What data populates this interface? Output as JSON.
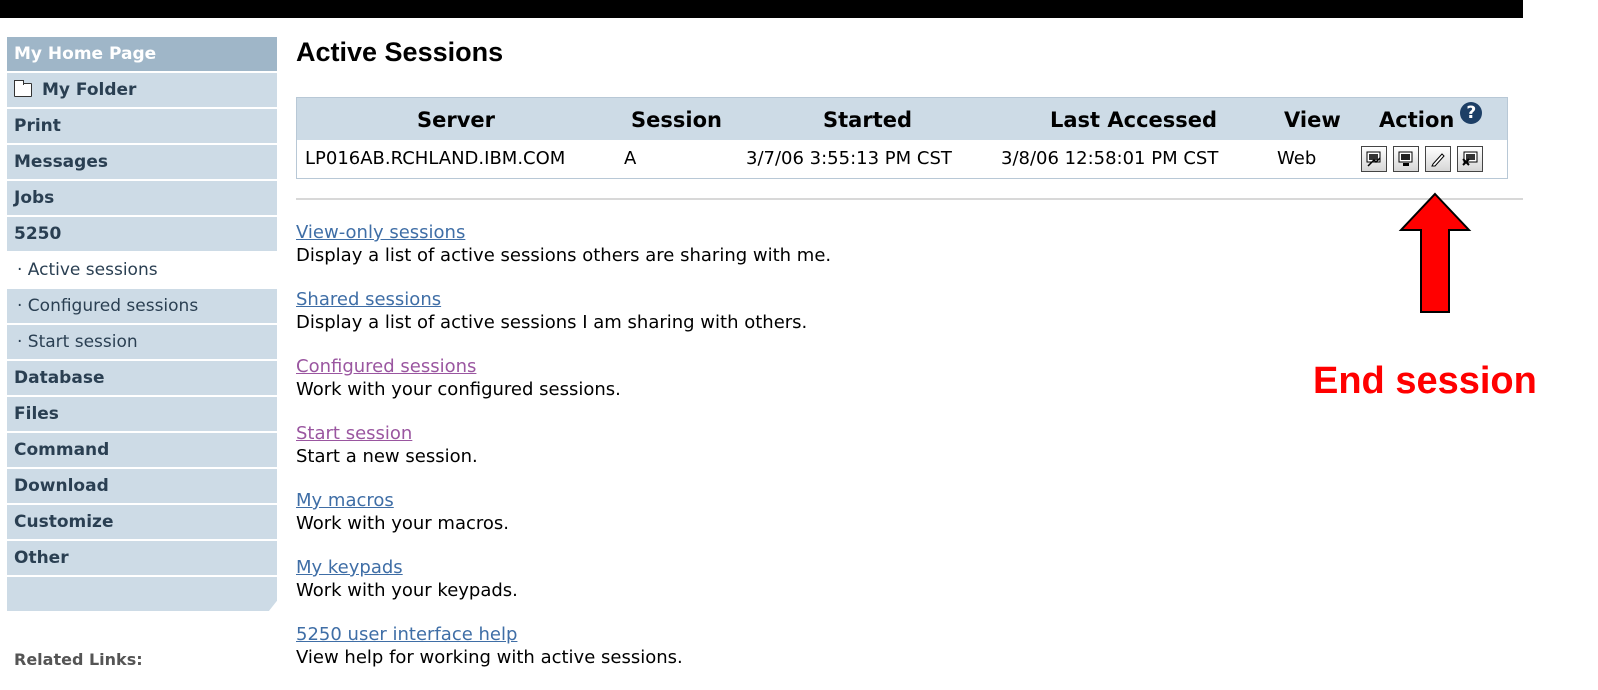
{
  "sidebar": {
    "items": [
      {
        "label": "My Home Page"
      },
      {
        "label": "My Folder"
      },
      {
        "label": "Print"
      },
      {
        "label": "Messages"
      },
      {
        "label": "Jobs"
      },
      {
        "label": "5250"
      },
      {
        "label": "· Active sessions"
      },
      {
        "label": "· Configured sessions"
      },
      {
        "label": "· Start session"
      },
      {
        "label": "Database"
      },
      {
        "label": "Files"
      },
      {
        "label": "Command"
      },
      {
        "label": "Download"
      },
      {
        "label": "Customize"
      },
      {
        "label": "Other"
      }
    ],
    "related_links_label": "Related Links:"
  },
  "main": {
    "title": "Active Sessions",
    "table": {
      "headers": [
        "Server",
        "Session",
        "Started",
        "Last Accessed",
        "View",
        "Action"
      ],
      "rows": [
        {
          "server": "LP016AB.RCHLAND.IBM.COM",
          "session": "A",
          "started": "3/7/06 3:55:13 PM CST",
          "last_accessed": "3/8/06 12:58:01 PM CST",
          "view": "Web"
        }
      ],
      "help_glyph": "?"
    },
    "links": [
      {
        "text": "View-only sessions",
        "desc": "Display a list of active sessions others are sharing with me."
      },
      {
        "text": "Shared sessions",
        "desc": "Display a list of active sessions I am sharing with others."
      },
      {
        "text": "Configured sessions",
        "desc": "Work with your configured sessions."
      },
      {
        "text": "Start session",
        "desc": "Start a new session."
      },
      {
        "text": "My macros",
        "desc": "Work with your macros."
      },
      {
        "text": "My keypads",
        "desc": "Work with your keypads."
      },
      {
        "text": "5250 user interface help",
        "desc": "View help for working with active sessions."
      }
    ]
  },
  "annotation": {
    "label": "End session",
    "color": "#ff0000"
  }
}
